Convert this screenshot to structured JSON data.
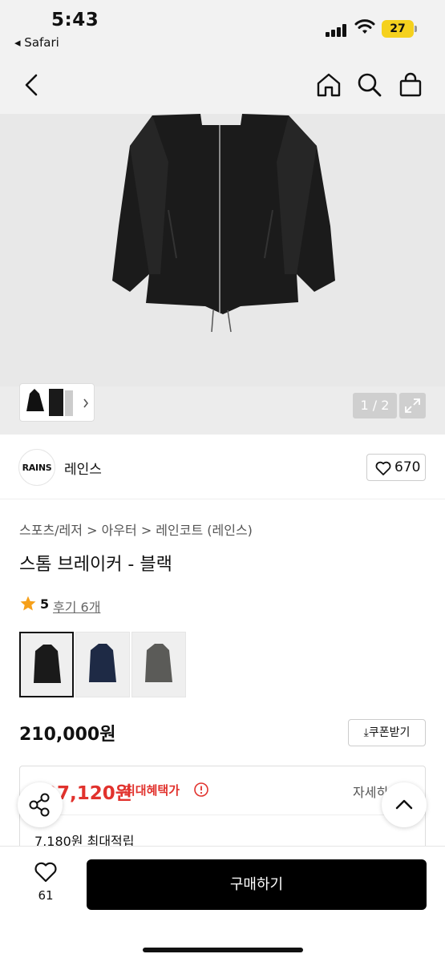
{
  "status_bar": {
    "time": "5:43",
    "back_app": "◂ Safari",
    "battery": "27"
  },
  "nav": {
    "back_icon": "chevron-left-icon",
    "home_icon": "home-icon",
    "search_icon": "search-icon",
    "cart_icon": "shopping-bag-icon"
  },
  "gallery": {
    "pager": "1 / 2"
  },
  "brand": {
    "logo_text": "RAINS",
    "name": "레인스",
    "like_count": "670"
  },
  "breadcrumb": "스포츠/레저 > 아우터 > 레인코트 (레인스)",
  "product": {
    "title": "스톰 브레이커 - 블랙",
    "rating": "5",
    "reviews": "후기 6개",
    "price": "210,000원",
    "coupon_label": "⤓쿠폰받기"
  },
  "benefit": {
    "max_price": "97,120원",
    "max_label": "최대혜택가",
    "detail_label": "자세히",
    "points": "7,180원 최대적립"
  },
  "bottom": {
    "wish_count": "61",
    "buy_label": "구매하기"
  },
  "colors": {
    "accent_red": "#e1322d",
    "star": "#f6a01a"
  }
}
